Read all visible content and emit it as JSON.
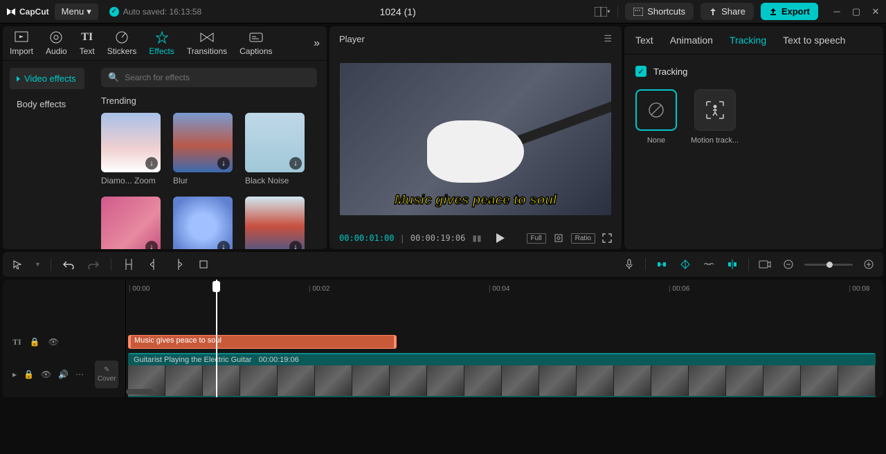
{
  "topbar": {
    "brand": "CapCut",
    "menu": "Menu",
    "autosaved": "Auto saved: 16:13:58",
    "title": "1024 (1)",
    "shortcuts": "Shortcuts",
    "share": "Share",
    "export": "Export"
  },
  "media_tabs": [
    "Import",
    "Audio",
    "Text",
    "Stickers",
    "Effects",
    "Transitions",
    "Captions"
  ],
  "media_tabs_active": "Effects",
  "effects_sidebar": {
    "items": [
      "Video effects",
      "Body effects"
    ],
    "active": "Video effects"
  },
  "search_placeholder": "Search for effects",
  "effects_section": "Trending",
  "effects": [
    {
      "name": "Diamo... Zoom",
      "bg": "linear-gradient(180deg,#a8c0e8 0%,#f0d0d0 60%,#fff 100%)"
    },
    {
      "name": "Blur",
      "bg": "linear-gradient(180deg,#7a9ad0 0%,#b85a4a 55%,#3a6ab0 100%)"
    },
    {
      "name": "Black Noise",
      "bg": "linear-gradient(180deg,#c0d8e8 0%,#a0c8d8 100%)"
    },
    {
      "name": "",
      "bg": "linear-gradient(135deg,#d05a8a 0%,#e88aa0 60%,#c04a7a 100%)"
    },
    {
      "name": "",
      "bg": "radial-gradient(circle,#a0c0ff 30%,#6080d0 80%)"
    },
    {
      "name": "",
      "bg": "linear-gradient(180deg,#d0e8f0 0%,#c85040 50%,#3a5a90 100%)"
    }
  ],
  "player": {
    "label": "Player",
    "overlay_text": "Music gives peace to soul",
    "current": "00:00:01:00",
    "total": "00:00:19:06",
    "full": "Full",
    "ratio": "Ratio"
  },
  "inspector": {
    "tabs": [
      "Text",
      "Animation",
      "Tracking",
      "Text to speech"
    ],
    "active": "Tracking",
    "section": "Tracking",
    "options": [
      {
        "label": "None",
        "selected": true
      },
      {
        "label": "Motion track...",
        "selected": false
      }
    ]
  },
  "timeline": {
    "ruler": [
      "00:00",
      "00:02",
      "00:04",
      "00:06",
      "00:08"
    ],
    "text_clip": "Music gives peace to soul",
    "video_clip": {
      "name": "Guitarist Playing the Electric Guitar",
      "duration": "00:00:19:06"
    },
    "cover": "Cover"
  }
}
